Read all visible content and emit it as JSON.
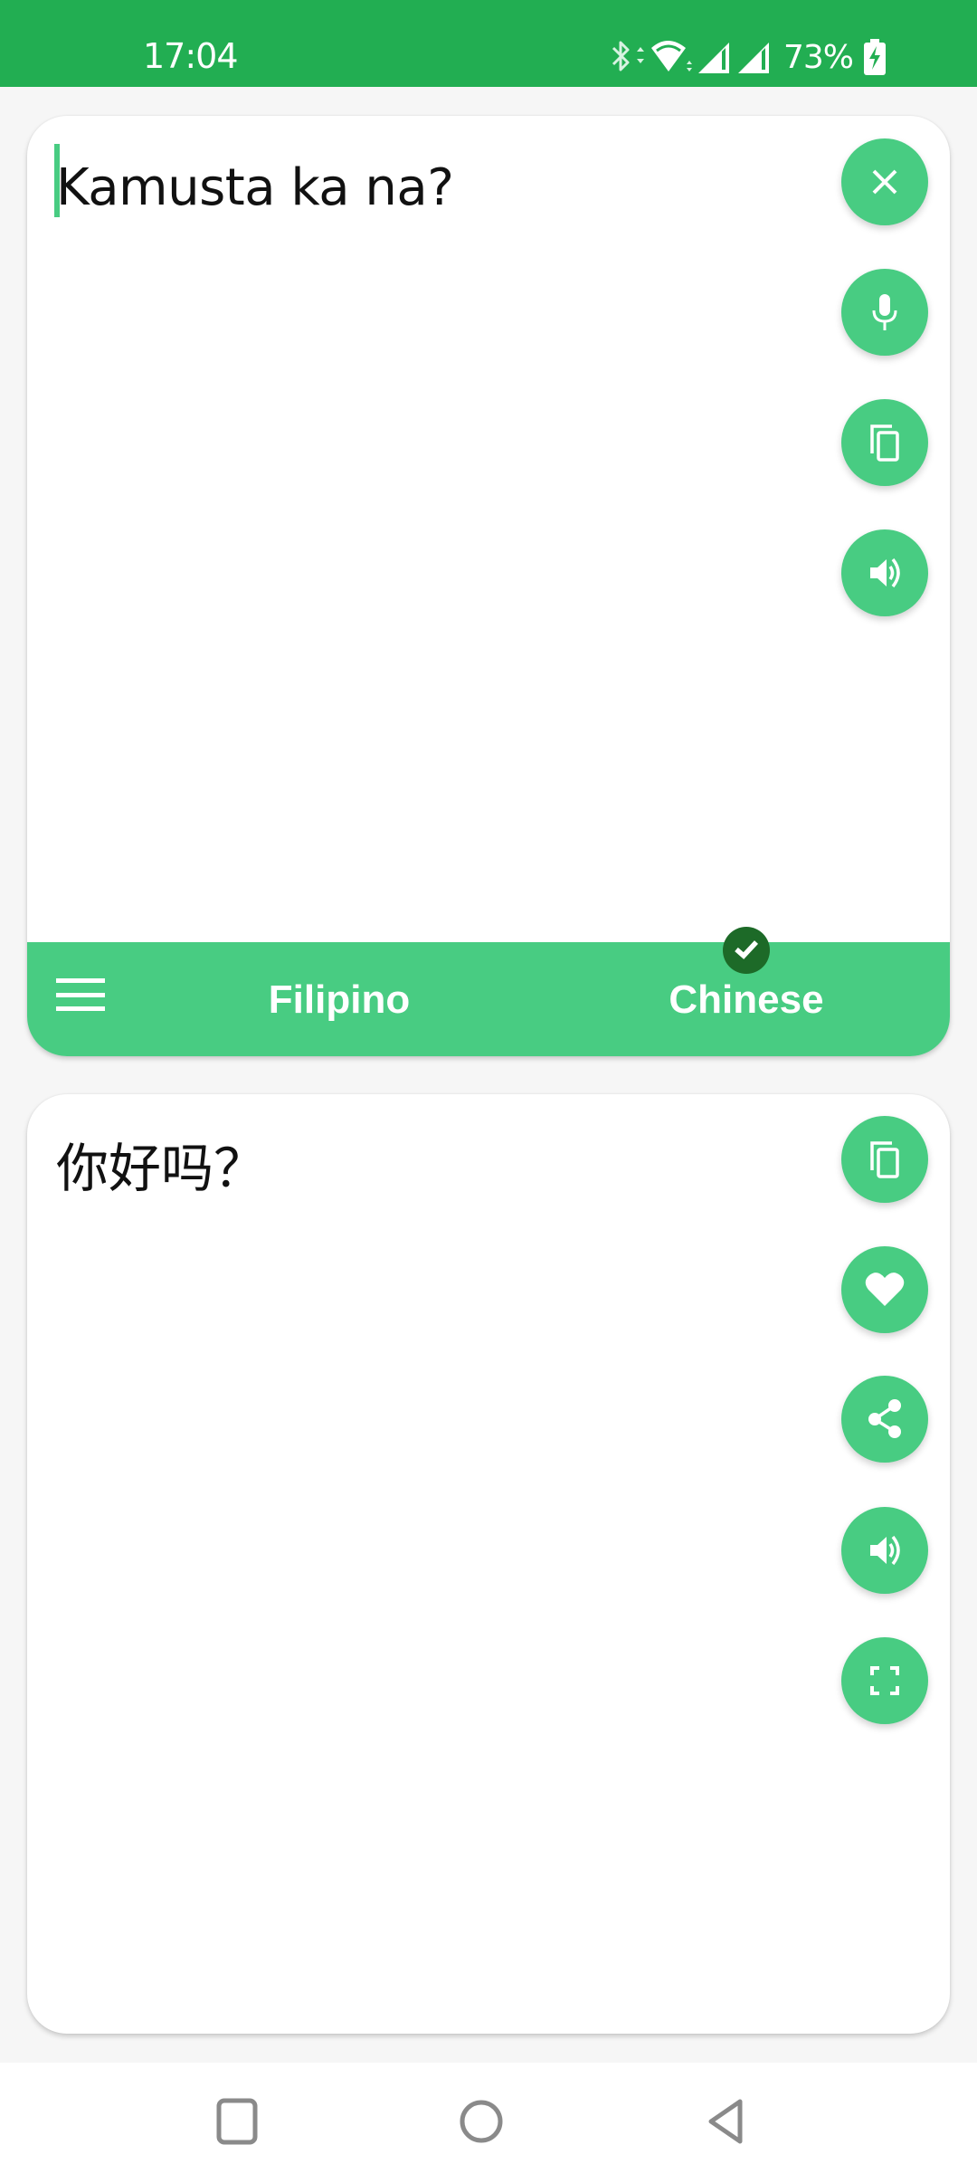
{
  "status_bar": {
    "time": "17:04",
    "battery_percent": "73%",
    "icons": [
      "bluetooth-icon",
      "wifi-icon",
      "signal-icon",
      "signal-icon",
      "battery-charging-icon"
    ],
    "color": "#22ae52"
  },
  "source": {
    "text": "Kamusta ka na?",
    "actions": [
      {
        "name": "clear",
        "icon": "close-icon"
      },
      {
        "name": "voice-input",
        "icon": "microphone-icon"
      },
      {
        "name": "paste",
        "icon": "copy-icon"
      },
      {
        "name": "speak",
        "icon": "speaker-icon"
      }
    ]
  },
  "language_bar": {
    "menu_icon": "menu-icon",
    "source_language": "Filipino",
    "target_language": "Chinese",
    "selected_indicator": "check-icon",
    "color": "#48cc82"
  },
  "translation": {
    "text": "你好吗？",
    "actions": [
      {
        "name": "copy",
        "icon": "copy-icon"
      },
      {
        "name": "favorite",
        "icon": "heart-icon"
      },
      {
        "name": "share",
        "icon": "share-icon"
      },
      {
        "name": "speak",
        "icon": "speaker-icon"
      },
      {
        "name": "fullscreen",
        "icon": "fullscreen-icon"
      }
    ]
  },
  "nav_bar": {
    "buttons": [
      "recents",
      "home",
      "back"
    ]
  },
  "colors": {
    "accent": "#48cc82",
    "status_bar": "#22ae52",
    "check_badge": "#1d6a28",
    "background": "#f6f6f6"
  }
}
